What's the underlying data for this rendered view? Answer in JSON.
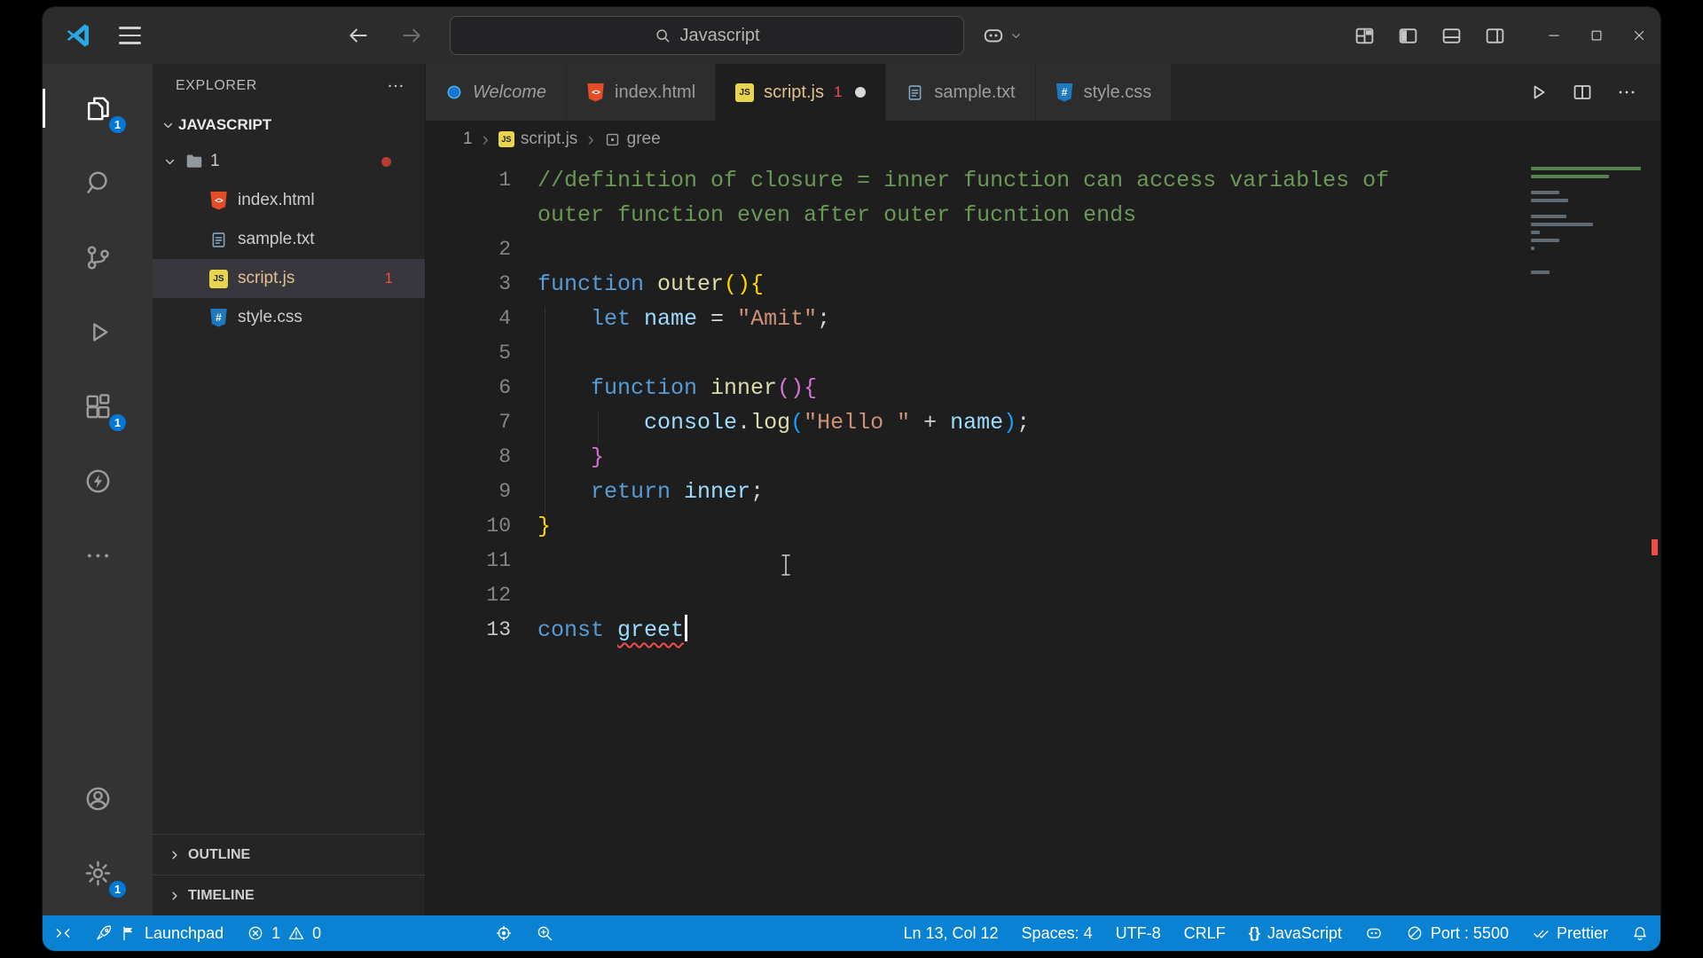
{
  "titlebar": {
    "search_text": "Javascript"
  },
  "activity_bar": {
    "explorer_badge": "1",
    "extensions_badge": "1",
    "settings_badge": "1"
  },
  "sidebar": {
    "title": "EXPLORER",
    "section_label": "JAVASCRIPT",
    "folder_name": "1",
    "files": [
      {
        "name": "index.html"
      },
      {
        "name": "sample.txt"
      },
      {
        "name": "script.js",
        "badge": "1"
      },
      {
        "name": "style.css"
      }
    ],
    "outline_label": "OUTLINE",
    "timeline_label": "TIMELINE"
  },
  "tabs": {
    "welcome": "Welcome",
    "index_html": "index.html",
    "script_js": "script.js",
    "script_js_badge": "1",
    "sample_txt": "sample.txt",
    "style_css": "style.css"
  },
  "breadcrumb": {
    "folder": "1",
    "file": "script.js",
    "symbol": "gree"
  },
  "editor": {
    "rows": [
      {
        "n": "1",
        "t": [
          [
            "cm",
            "//definition of closure = inner function can access variables of"
          ]
        ]
      },
      {
        "n": "",
        "t": [
          [
            "cm",
            "outer function even after outer fucntion ends"
          ]
        ]
      },
      {
        "n": "2",
        "t": []
      },
      {
        "n": "3",
        "t": [
          [
            "kw",
            "function "
          ],
          [
            "fn",
            "outer"
          ],
          [
            "b1",
            "(){"
          ]
        ]
      },
      {
        "n": "4",
        "t": [
          [
            "pl",
            "    "
          ],
          [
            "kw",
            "let "
          ],
          [
            "vr",
            "name"
          ],
          [
            "pl",
            " = "
          ],
          [
            "st",
            "\"Amit\""
          ],
          [
            "pl",
            ";"
          ]
        ]
      },
      {
        "n": "5",
        "t": []
      },
      {
        "n": "6",
        "t": [
          [
            "pl",
            "    "
          ],
          [
            "kw",
            "function "
          ],
          [
            "fn",
            "inner"
          ],
          [
            "b2",
            "(){"
          ]
        ]
      },
      {
        "n": "7",
        "t": [
          [
            "pl",
            "        "
          ],
          [
            "vr",
            "console"
          ],
          [
            "pl",
            "."
          ],
          [
            "fn",
            "log"
          ],
          [
            "b3",
            "("
          ],
          [
            "st",
            "\"Hello \""
          ],
          [
            "pl",
            " + "
          ],
          [
            "vr",
            "name"
          ],
          [
            "b3",
            ")"
          ],
          [
            "pl",
            ";"
          ]
        ]
      },
      {
        "n": "8",
        "t": [
          [
            "pl",
            "    "
          ],
          [
            "b2",
            "}"
          ]
        ]
      },
      {
        "n": "9",
        "t": [
          [
            "pl",
            "    "
          ],
          [
            "kw",
            "return "
          ],
          [
            "vr",
            "inner"
          ],
          [
            "pl",
            ";"
          ]
        ]
      },
      {
        "n": "10",
        "t": [
          [
            "b1",
            "}"
          ]
        ]
      },
      {
        "n": "11",
        "t": []
      },
      {
        "n": "12",
        "t": []
      },
      {
        "n": "13",
        "t": [
          [
            "kw",
            "const "
          ],
          [
            "err",
            "greet"
          ]
        ]
      }
    ]
  },
  "status_bar": {
    "launchpad": "Launchpad",
    "errors": "1",
    "warnings": "0",
    "cursor_position": "Ln 13, Col 12",
    "indentation": "Spaces: 4",
    "encoding": "UTF-8",
    "eol": "CRLF",
    "language_brackets": "{}",
    "language": "JavaScript",
    "port": "Port : 5500",
    "formatter": "Prettier"
  }
}
